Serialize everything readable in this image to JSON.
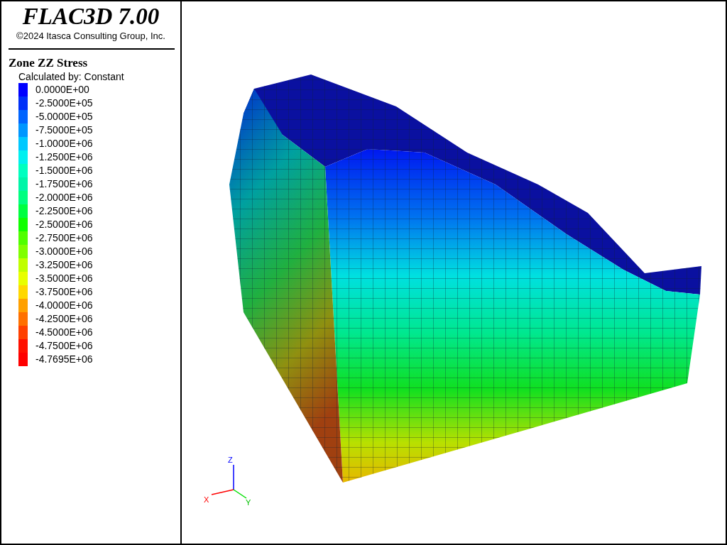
{
  "header": {
    "title": "FLAC3D 7.00",
    "copyright": "©2024 Itasca Consulting Group, Inc."
  },
  "legend": {
    "title": "Zone ZZ Stress",
    "subtitle": "Calculated by: Constant",
    "entries": [
      {
        "label": "0.0000E+00",
        "color": "#0000ff"
      },
      {
        "label": "-2.5000E+05",
        "color": "#0030f8"
      },
      {
        "label": "-5.0000E+05",
        "color": "#0064ff"
      },
      {
        "label": "-7.5000E+05",
        "color": "#0096ff"
      },
      {
        "label": "-1.0000E+06",
        "color": "#00c8ff"
      },
      {
        "label": "-1.2500E+06",
        "color": "#00f0f0"
      },
      {
        "label": "-1.5000E+06",
        "color": "#00ffc0"
      },
      {
        "label": "-1.7500E+06",
        "color": "#00f5a8"
      },
      {
        "label": "-2.0000E+06",
        "color": "#00ff80"
      },
      {
        "label": "-2.2500E+06",
        "color": "#00ff40"
      },
      {
        "label": "-2.5000E+06",
        "color": "#10ff00"
      },
      {
        "label": "-2.7500E+06",
        "color": "#50ff00"
      },
      {
        "label": "-3.0000E+06",
        "color": "#80ff00"
      },
      {
        "label": "-3.2500E+06",
        "color": "#c0ff00"
      },
      {
        "label": "-3.5000E+06",
        "color": "#e8ff00"
      },
      {
        "label": "-3.7500E+06",
        "color": "#ffd800"
      },
      {
        "label": "-4.0000E+06",
        "color": "#ffa000"
      },
      {
        "label": "-4.2500E+06",
        "color": "#ff7000"
      },
      {
        "label": "-4.5000E+06",
        "color": "#ff4000"
      },
      {
        "label": "-4.7500E+06",
        "color": "#ff1000"
      },
      {
        "label": "-4.7695E+06",
        "color": "#ff0000"
      }
    ]
  },
  "axes": {
    "x": "X",
    "y": "Y",
    "z": "Z"
  }
}
